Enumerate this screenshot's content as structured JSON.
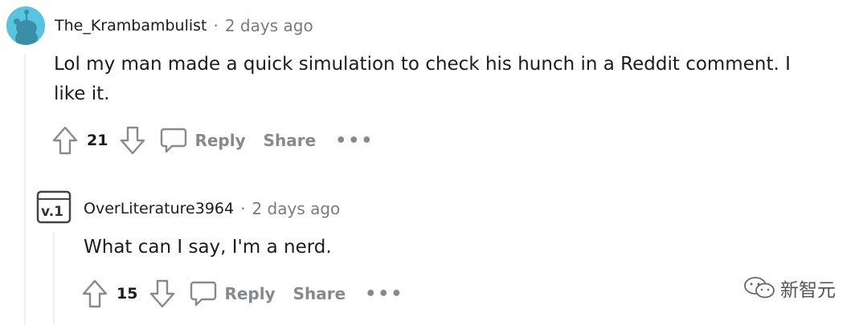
{
  "comments": [
    {
      "username": "The_Krambambulist",
      "separator": "·",
      "time": "2 days ago",
      "body_line1": "Lol my man made a quick simulation to check his hunch in a Reddit comment. I",
      "body_line2": "like it.",
      "score": "21",
      "reply_label": "Reply",
      "share_label": "Share",
      "more_label": "•••",
      "avatar_icon": "snoo-avatar-icon"
    },
    {
      "username": "OverLiterature3964",
      "separator": "·",
      "time": "2 days ago",
      "body": "What can I say, I'm a nerd.",
      "score": "15",
      "reply_label": "Reply",
      "share_label": "Share",
      "more_label": "•••",
      "avatar_text": "v.1",
      "avatar_icon": "version-badge-avatar-icon"
    }
  ],
  "watermark": {
    "text": "新智元",
    "icon": "wechat-icon"
  },
  "colors": {
    "meta": "#787c7e",
    "action": "#878a8c",
    "thread_line": "#edeff1",
    "avatar_bg": "#58c4e0"
  }
}
